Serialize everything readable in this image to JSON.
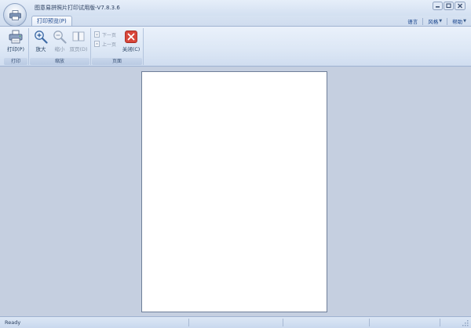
{
  "window": {
    "title": "图意易拼照片打印试用版-V7.8.3.6"
  },
  "ribbon": {
    "tabs": [
      {
        "label": "打印预览(P)",
        "active": true
      }
    ],
    "right_menu": [
      "语言",
      "风格",
      "帮助"
    ],
    "groups": {
      "print": {
        "label": "打印",
        "print_button": "打印(P)"
      },
      "zoom": {
        "label": "缩放",
        "zoom_in": "放大",
        "zoom_out": "缩小",
        "two_pages": "双页(D)"
      },
      "page": {
        "label": "页面",
        "next_page": "下一页",
        "prev_page": "上一页",
        "close": "关闭(C)"
      }
    }
  },
  "statusbar": {
    "text": "Ready"
  },
  "colors": {
    "accent": "#15428b",
    "workspace": "#c5cfe0",
    "close_icon": "#d8463a"
  }
}
